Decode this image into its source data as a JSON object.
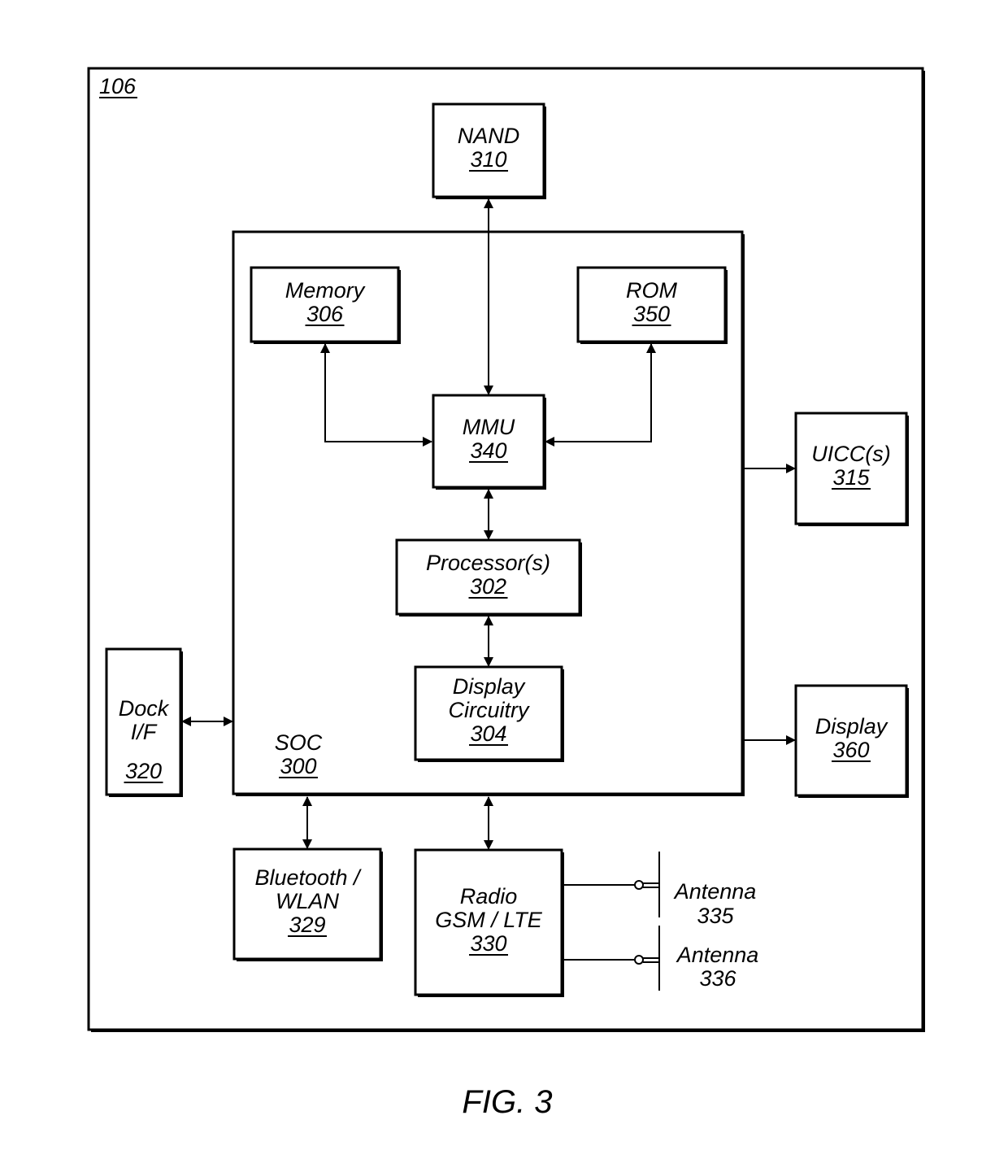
{
  "figure": {
    "caption": "FIG. 3",
    "device_ref": "106"
  },
  "soc": {
    "name": "SOC",
    "ref": "300"
  },
  "blocks": {
    "nand": {
      "lines": [
        "NAND"
      ],
      "ref": "310"
    },
    "memory": {
      "lines": [
        "Memory"
      ],
      "ref": "306"
    },
    "rom": {
      "lines": [
        "ROM"
      ],
      "ref": "350"
    },
    "mmu": {
      "lines": [
        "MMU"
      ],
      "ref": "340"
    },
    "processor": {
      "lines": [
        "Processor(s)"
      ],
      "ref": "302"
    },
    "display_circuitry": {
      "lines": [
        "Display",
        "Circuitry"
      ],
      "ref": "304"
    },
    "uicc": {
      "lines": [
        "UICC(s)"
      ],
      "ref": "315"
    },
    "display": {
      "lines": [
        "Display"
      ],
      "ref": "360"
    },
    "dock": {
      "lines": [
        "Dock",
        "I/F"
      ],
      "ref": "320"
    },
    "bluetooth": {
      "lines": [
        "Bluetooth /",
        "WLAN"
      ],
      "ref": "329"
    },
    "radio": {
      "lines": [
        "Radio",
        "GSM / LTE"
      ],
      "ref": "330"
    }
  },
  "antennas": [
    {
      "label": "Antenna",
      "ref": "335"
    },
    {
      "label": "Antenna",
      "ref": "336"
    }
  ]
}
